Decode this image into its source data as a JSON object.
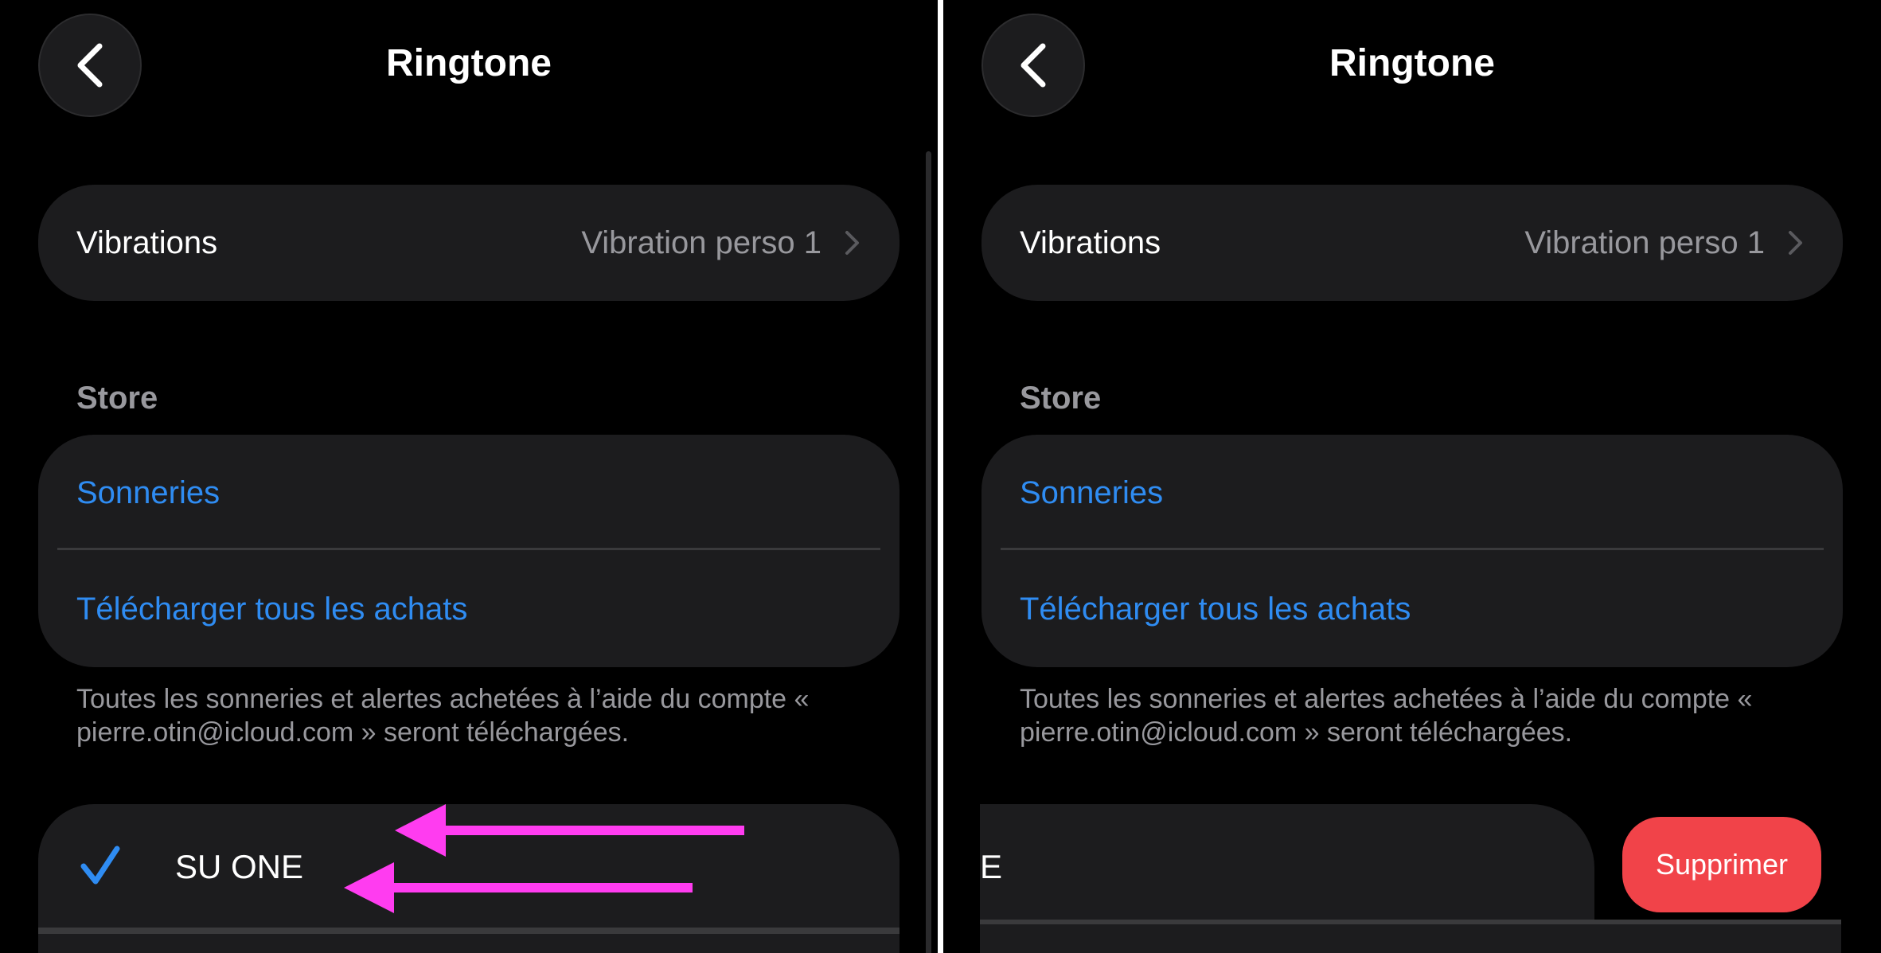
{
  "nav": {
    "title": "Ringtone",
    "back_icon": "chevron-left-icon"
  },
  "vibrations": {
    "label": "Vibrations",
    "value": "Vibration perso 1",
    "icon": "chevron-right-icon"
  },
  "store": {
    "header": "Store",
    "items": [
      {
        "label": "Sonneries"
      },
      {
        "label": "Télécharger tous les achats"
      }
    ],
    "footnote": "Toutes les sonneries et alertes achetées à l’aide du compte « pierre.otin@icloud.com » seront téléchargées."
  },
  "ringtones": {
    "selected": {
      "label": "SU ONE",
      "icon": "checkmark-icon"
    }
  },
  "swipe": {
    "clipped_text": "E",
    "delete_label": "Supprimer"
  },
  "colors": {
    "background": "#000000",
    "card": "#1c1c1e",
    "link": "#2f8cf2",
    "secondary_text": "#98989d",
    "delete": "#f14349",
    "annotation_arrow": "#ff3cf0"
  },
  "annotations": {
    "arrows": 2,
    "icon": "arrow-left-icon"
  }
}
